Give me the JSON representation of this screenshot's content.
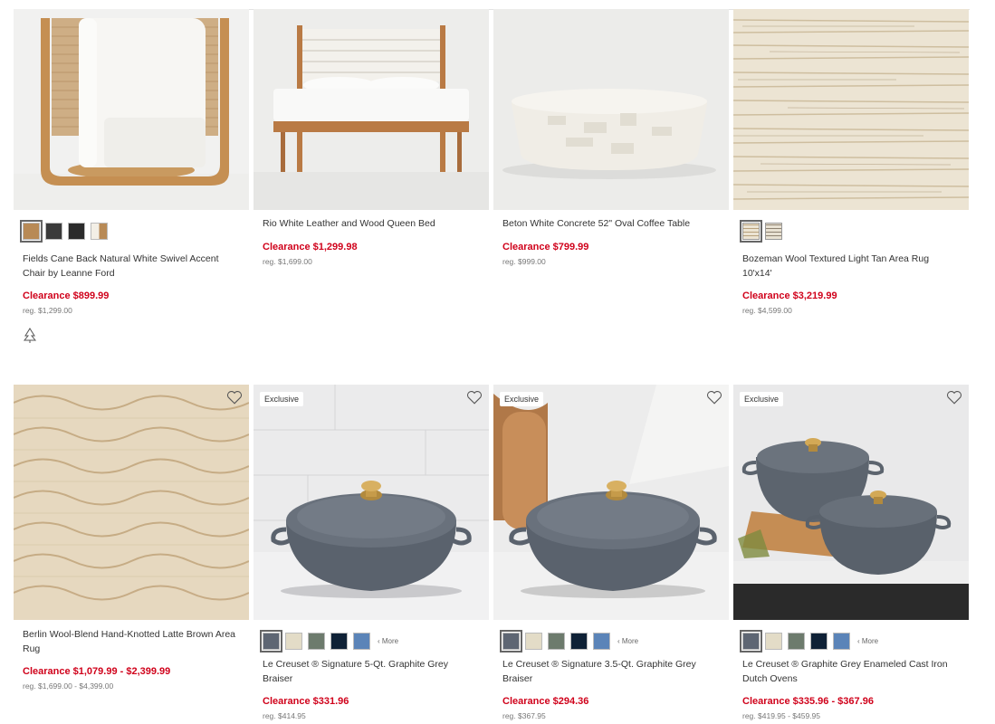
{
  "row1": [
    {
      "name": "Fields Cane Back Natural White Swivel Accent Chair by Leanne Ford",
      "price": "Clearance $899.99",
      "reg": "reg. $1,299.00",
      "swatches": [
        "#b88a56",
        "#3a3a3a",
        "#2b2b2b",
        "#d9c9ae"
      ]
    },
    {
      "name": "Rio White Leather and Wood Queen Bed",
      "price": "Clearance $1,299.98",
      "reg": "reg. $1,699.00"
    },
    {
      "name": "Beton White Concrete 52\" Oval Coffee Table",
      "price": "Clearance $799.99",
      "reg": "reg. $999.00"
    },
    {
      "name": "Bozeman Wool Textured Light Tan Area Rug 10'x14'",
      "price": "Clearance $3,219.99",
      "reg": "reg. $4,599.00"
    }
  ],
  "row2": [
    {
      "name": "Berlin Wool-Blend Hand-Knotted Latte Brown Area Rug",
      "price": "Clearance $1,079.99 - $2,399.99",
      "reg": "reg. $1,699.00 - $4,399.00"
    },
    {
      "badge": "Exclusive",
      "name": "Le Creuset ® Signature 5-Qt. Graphite Grey Braiser",
      "price": "Clearance $331.96",
      "reg": "reg. $414.95",
      "more": "‹ More"
    },
    {
      "badge": "Exclusive",
      "name": "Le Creuset ® Signature 3.5-Qt. Graphite Grey Braiser",
      "price": "Clearance $294.36",
      "reg": "reg. $367.95",
      "more": "‹ More"
    },
    {
      "badge": "Exclusive",
      "name": "Le Creuset ® Graphite Grey Enameled Cast Iron Dutch Ovens",
      "price": "Clearance $335.96 - $367.96",
      "reg": "reg. $419.95 - $459.95",
      "more": "‹ More"
    }
  ],
  "cookware_swatches": [
    "#5e6673",
    "#e3dcc7",
    "#6d7b6d",
    "#0f2136",
    "#5b84b8"
  ],
  "colors": {
    "clearance_red": "#d0021b"
  },
  "icons": [
    "heart-icon",
    "tree-icon"
  ]
}
